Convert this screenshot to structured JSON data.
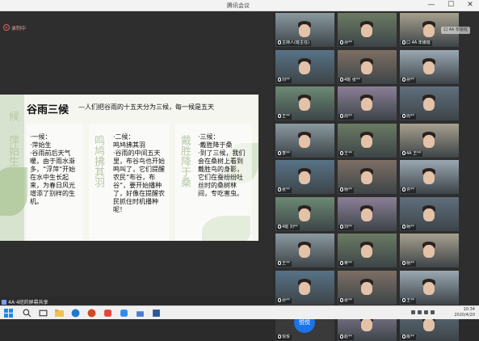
{
  "window": {
    "title": "腾讯会议",
    "minimize_glyph": "—",
    "maximize_glyph": "☐",
    "close_glyph": "✕"
  },
  "recording": {
    "label": "录制中"
  },
  "slide": {
    "title": "谷雨三候",
    "subtitle": "—人们把谷雨的十五天分为三候，每一候是五天",
    "vertical_left": "候",
    "vertical_col1": "萍始生",
    "vertical_col2": "鸣鸠拂其羽",
    "vertical_col3": "戴胜降于桑",
    "col1": {
      "heading": "·一候：",
      "name": "·萍始生",
      "body": "·谷雨前后天气暖，由于雨水渐多，“浮萍”开始在水中生长起来，为春日风光增添了别样的生机。"
    },
    "col2": {
      "heading": "·二候：",
      "name": "鸣鸠拂其羽",
      "body": "·谷雨的中间五天里，布谷鸟也开始鸣叫了，它们提醒农民“布谷，布谷”，要开始播种了，好像在提醒农民抓住时机播种呢！"
    },
    "col3": {
      "heading": "·三候：",
      "name": "·戴胜降于桑",
      "body": "·到了三候，我们会在桑树上看到戴胜鸟的身影，它们在蚕纷纷吐丝时的桑树林间，专吃害虫。"
    }
  },
  "share_bar": {
    "label": "4A·4班的屏幕共享"
  },
  "gallery": {
    "search_overlay": "口 4A 年级班",
    "avatar_text": "悦悦",
    "tiles": [
      {
        "name": "主持人(班主任)"
      },
      {
        "name": "孙**"
      },
      {
        "name": "口 4A 年级班"
      },
      {
        "name": "刘**"
      },
      {
        "name": "4班 张**"
      },
      {
        "name": "孙**"
      },
      {
        "name": "王**"
      },
      {
        "name": "周**"
      },
      {
        "name": "周**"
      },
      {
        "name": "李**"
      },
      {
        "name": "王**"
      },
      {
        "name": "4A 王**"
      },
      {
        "name": "张**"
      },
      {
        "name": "杨**"
      },
      {
        "name": "许**"
      },
      {
        "name": "4班 刘**"
      },
      {
        "name": "刘**"
      },
      {
        "name": "杨**"
      },
      {
        "name": "王**"
      },
      {
        "name": "蒋**"
      },
      {
        "name": "杨**"
      },
      {
        "name": "孙**"
      },
      {
        "name": "张**"
      },
      {
        "name": "王**"
      },
      {
        "name": "悦悦"
      },
      {
        "name": "赵**"
      },
      {
        "name": "陈**"
      }
    ]
  },
  "taskbar": {
    "time": "10:34",
    "date": "2020/4/20"
  }
}
